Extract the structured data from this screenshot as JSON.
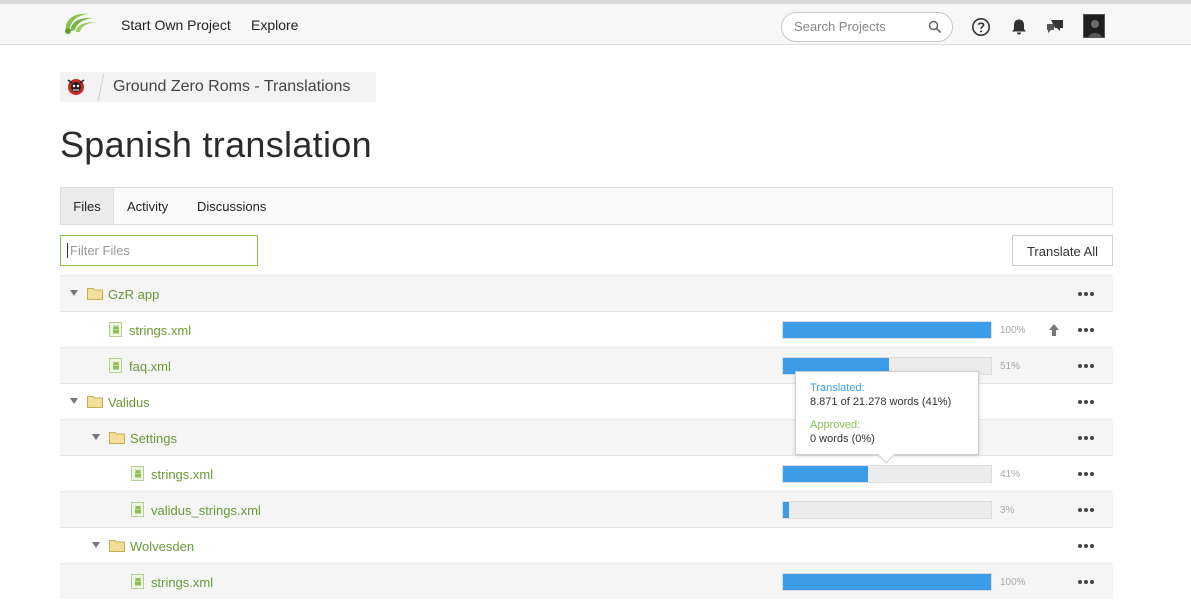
{
  "nav": {
    "start_project": "Start Own Project",
    "explore": "Explore",
    "search_placeholder": "Search Projects"
  },
  "breadcrumb": {
    "project": "Ground Zero Roms - Translations"
  },
  "page": {
    "title": "Spanish translation"
  },
  "tabs": {
    "files": "Files",
    "activity": "Activity",
    "discussions": "Discussions"
  },
  "toolbar": {
    "filter_placeholder": "Filter Files",
    "translate_all": "Translate All"
  },
  "colors": {
    "accent_green": "#8cc152",
    "progress_blue": "#3c9ce8",
    "file_label": "#6a9a36"
  },
  "tree": [
    {
      "kind": "folder",
      "level": 0,
      "label": "GzR app"
    },
    {
      "kind": "file",
      "level": 1,
      "label": "strings.xml",
      "progress": 100,
      "progress_label": "100%",
      "upload": true
    },
    {
      "kind": "file",
      "level": 1,
      "label": "faq.xml",
      "progress": 51,
      "progress_label": "51%"
    },
    {
      "kind": "folder",
      "level": 0,
      "label": "Validus"
    },
    {
      "kind": "folder",
      "level": 1,
      "label": "Settings"
    },
    {
      "kind": "file",
      "level": 2,
      "label": "strings.xml",
      "progress": 41,
      "progress_label": "41%"
    },
    {
      "kind": "file",
      "level": 2,
      "label": "validus_strings.xml",
      "progress": 3,
      "progress_label": "3%"
    },
    {
      "kind": "folder",
      "level": 1,
      "label": "Wolvesden"
    },
    {
      "kind": "file",
      "level": 2,
      "label": "strings.xml",
      "progress": 100,
      "progress_label": "100%"
    }
  ],
  "tooltip": {
    "translated_heading": "Translated:",
    "translated_value": "8.871 of 21.278 words (41%)",
    "approved_heading": "Approved:",
    "approved_value": "0 words (0%)"
  }
}
